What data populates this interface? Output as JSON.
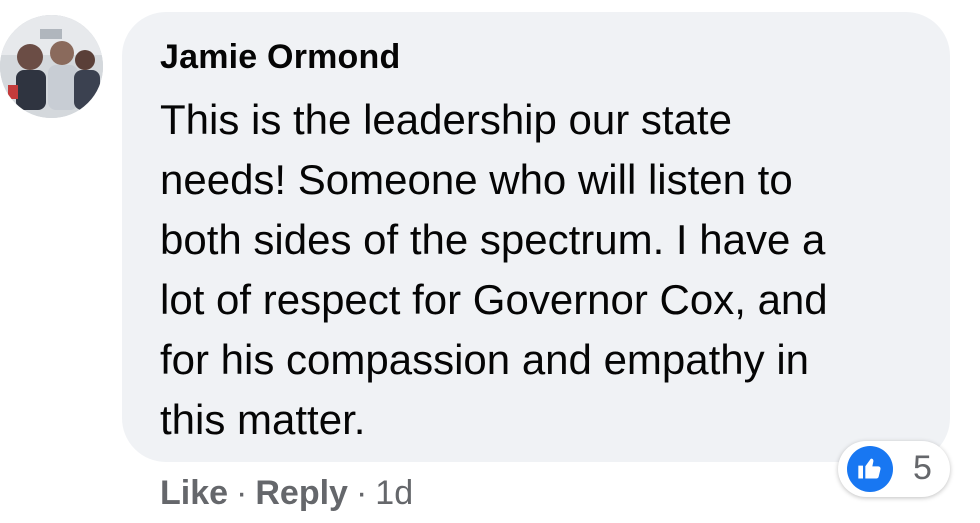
{
  "comment": {
    "author": "Jamie Ormond",
    "lines": [
      "This is the leadership our state",
      "needs! Someone who will listen to",
      "both sides of the spectrum. I have a",
      "lot of respect for Governor Cox, and",
      "for his compassion and empathy in",
      "this matter."
    ],
    "reaction_icon": "thumbs-up-icon",
    "reaction_count": "5",
    "accent_color": "#1877f2",
    "bubble_color": "#f0f2f5"
  },
  "actions": {
    "like_label": "Like",
    "separator": "·",
    "reply_label": "Reply",
    "timestamp": "1d"
  }
}
